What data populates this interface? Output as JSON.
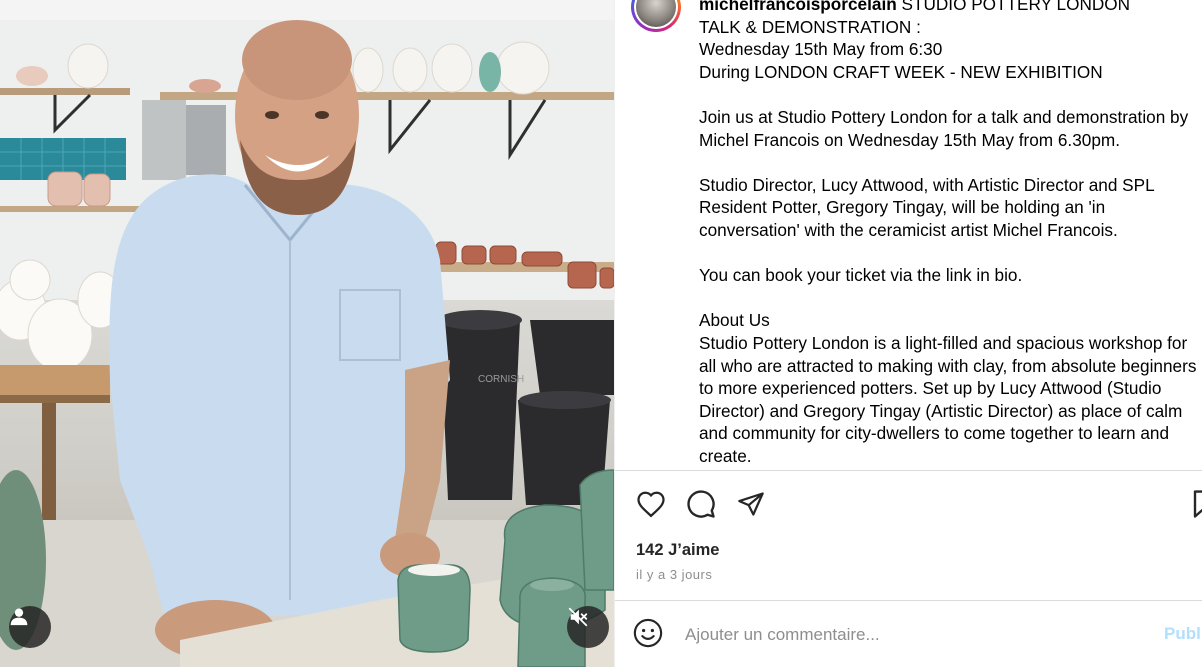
{
  "post": {
    "username": "michelfrancoisporcelain",
    "caption_text": " STUDIO POTTERY LONDON\nTALK & DEMONSTRATION :\nWednesday 15th May from 6:30\nDuring LONDON CRAFT WEEK - NEW EXHIBITION\n\nJoin us at Studio Pottery London for a talk and demonstration by Michel Francois on Wednesday 15th May from 6.30pm.\n\nStudio Director, Lucy Attwood, with Artistic Director and SPL Resident Potter, Gregory Tingay, will be holding an 'in conversation' with the ceramicist artist Michel Francois.\n\nYou can book your ticket via the link in bio.\n\nAbout Us\nStudio Pottery London is a light-filled and spacious workshop for all who are attracted to making with clay, from absolute beginners to more experienced potters. Set up by Lucy Attwood (Studio Director) and Gregory Tingay (Artistic Director) as place of calm and community for city-dwellers to come together to learn and create.",
    "likes": "142 J’aime",
    "time_ago": "il y a 3 jours"
  },
  "media": {
    "bin_label": "CORNISH",
    "icons": {
      "tag": "person-icon",
      "mute": "muted-speaker-icon"
    }
  },
  "actions": {
    "icons": [
      "heart-icon",
      "comment-bubble-icon",
      "paper-plane-icon",
      "bookmark-icon"
    ]
  },
  "comment": {
    "placeholder": "Ajouter un commentaire...",
    "publish_label": "Publier"
  },
  "colors": {
    "publish_disabled": "#b2dffc",
    "secondary_text": "#8e8e8e",
    "divider": "#dbdbdb"
  }
}
